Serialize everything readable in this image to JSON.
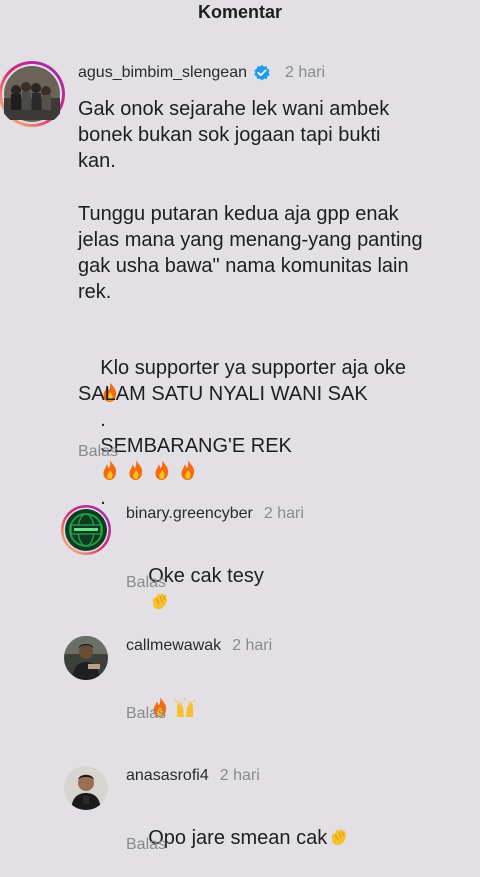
{
  "header": {
    "title": "Komentar"
  },
  "main_comment": {
    "username": "agus_bimbim_slengean",
    "time": "2 hari",
    "paragraph1": "Gak onok sejarahe lek wani ambek\nbonek bukan sok jogaan tapi bukti\nkan.",
    "paragraph2": "Tunggu putaran kedua aja gpp enak\njelas mana yang menang-yang panting\ngak usha bawa\" nama komunitas lain\nrek.",
    "paragraph3": "Klo supporter ya supporter aja oke",
    "paragraph4_line1": "SALAM SATU NYALI WANI SAK",
    "paragraph4_line2": "SEMBARANG'E REK",
    "period": ".",
    "reply_label": "Balas",
    "avatar_icon": "group-photo-avatar",
    "verified_icon": "verified-badge-icon"
  },
  "replies": [
    {
      "username": "binary.greencyber",
      "time": "2 hari",
      "text": "Oke cak tesy",
      "reply_label": "Balas",
      "avatar_icon": "green-cyber-logo-avatar",
      "emoji_icon": "clapping-hands-icon"
    },
    {
      "username": "callmewawak",
      "time": "2 hari",
      "text": "",
      "reply_label": "Balas",
      "avatar_icon": "person-photo-avatar",
      "emoji_icons": [
        "fire-icon",
        "raising-hands-icon"
      ]
    },
    {
      "username": "anasasrofi4",
      "time": "2 hari",
      "text": "Opo jare smean cak",
      "reply_label": "Balas",
      "avatar_icon": "person-photo-avatar",
      "emoji_icon": "clapping-hands-icon"
    }
  ],
  "colors": {
    "background": "#e2e0e4",
    "verified": "#1d9bf0",
    "muted": "#8a8a8e",
    "story_ring": "#d62976"
  }
}
